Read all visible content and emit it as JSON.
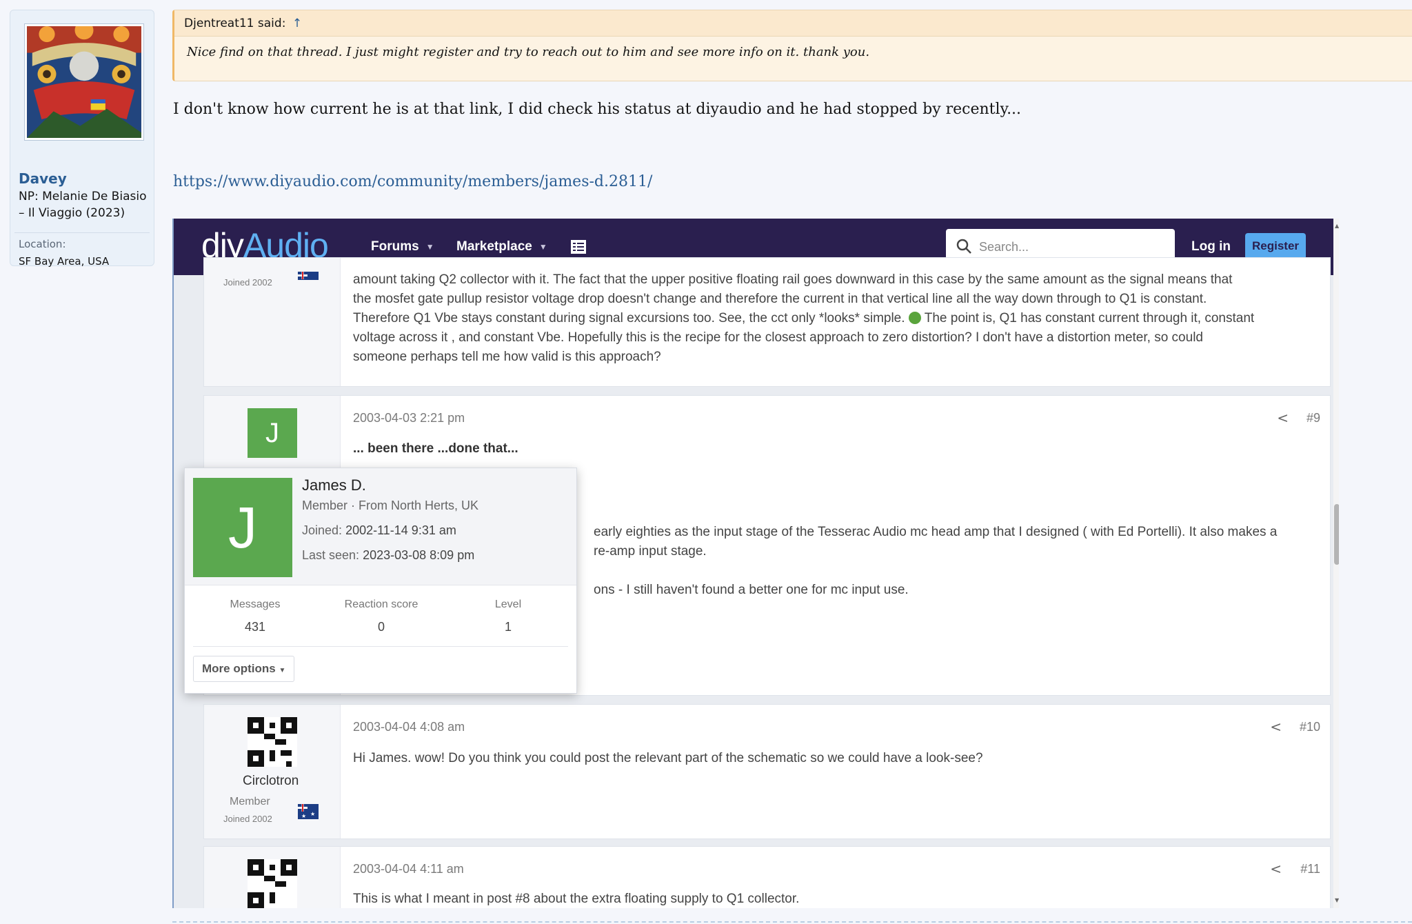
{
  "author": {
    "name": "Davey",
    "user_title": "NP: Melanie De Biasio – Il Viaggio (2023)",
    "location_label": "Location:",
    "location": "SF Bay Area, USA"
  },
  "quote": {
    "attribution": "Djentreat11 said:",
    "jump_glyph": "↑",
    "text": "Nice find on that thread. I just might register and try to reach out to him and see more info on it. thank you."
  },
  "message": {
    "text": "I don't know how current he is at that link, I did check his status at diyaudio and he had stopped by recently...",
    "link": "https://www.diyaudio.com/community/members/james-d.2811/"
  },
  "embedded": {
    "logo_part1": "diy",
    "logo_part2": "Audio",
    "nav_forums": "Forums",
    "nav_marketplace": "Marketplace",
    "search_placeholder": "Search...",
    "login": "Log in",
    "register": "Register",
    "post8": {
      "joined": "Joined 2002",
      "line1": "amount taking Q2 collector with it. The fact that the upper positive floating rail goes downward in this case by the same amount as the signal means that",
      "line2": "the mosfet gate pullup resistor voltage drop doesn't change and therefore the current in that vertical line all the way down through to Q1 is constant.",
      "line3": "Therefore Q1 Vbe stays constant during signal excursions too. See, the cct only *looks* simple.",
      "line3b": "The point is, Q1 has constant current through it, constant",
      "line4": "voltage across it , and constant Vbe. Hopefully this is the recipe for the closest approach to zero distortion? I don't have a distortion meter, so could",
      "line5": "someone perhaps tell me how valid is this approach?"
    },
    "post9": {
      "avatar_letter": "J",
      "date": "2003-04-03 2:21 pm",
      "num": "#9",
      "line1": "... been there ...done that...",
      "line2": "early eighties as the input stage of the Tesserac Audio mc head amp that I designed ( with Ed Portelli). It also makes a",
      "line3": "re-amp input stage.",
      "line4": "ons - I still haven't found a better one for mc input use."
    },
    "popup": {
      "avatar_letter": "J",
      "name": "James D.",
      "role": "Member · From North Herts, UK",
      "joined_label": "Joined:",
      "joined": "2002-11-14 9:31 am",
      "lastseen_label": "Last seen:",
      "lastseen": "2023-03-08 8:09 pm",
      "messages_label": "Messages",
      "messages": "431",
      "reaction_label": "Reaction score",
      "reaction": "0",
      "level_label": "Level",
      "level": "1",
      "more_options": "More options"
    },
    "post10": {
      "username": "Circlotron",
      "role": "Member",
      "joined": "Joined 2002",
      "date": "2003-04-04 4:08 am",
      "num": "#10",
      "text": "Hi James. wow! Do you think you could post the relevant part of the schematic so we could have a look-see?"
    },
    "post11": {
      "date": "2003-04-04 4:11 am",
      "num": "#11",
      "text": "This is what I meant in post #8 about the extra floating supply to Q1 collector."
    }
  }
}
